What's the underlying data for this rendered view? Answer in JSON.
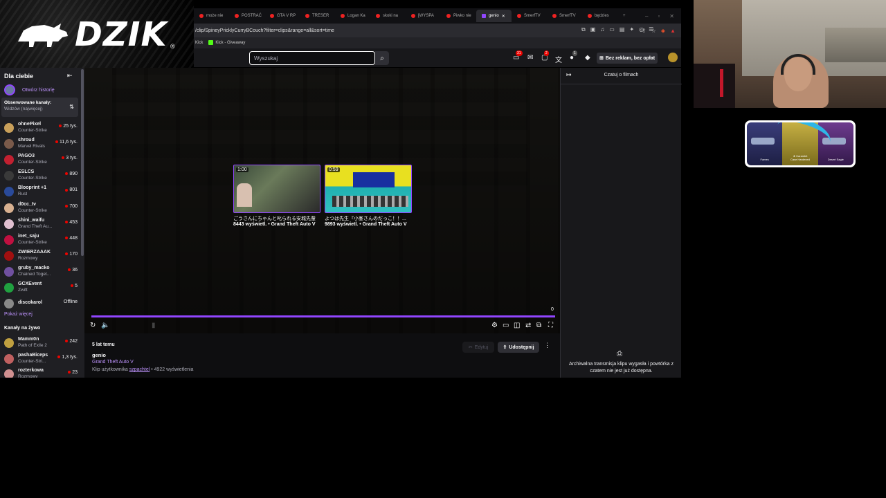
{
  "overlay": {
    "logo_text": "DZIK",
    "logo_mark": "®"
  },
  "browser": {
    "tabs": [
      "może nie",
      "POSTRAĆ",
      "GTA V RP",
      "TRESER",
      "Logan Ka",
      "skoki na",
      "[WYSPA",
      "Piwko nie",
      "genio",
      "SmerfTV",
      "SmerfTV",
      "będzies"
    ],
    "active_tab_index": 8,
    "url": "/clip/SpineyPricklyCurryBCouch?filter=clips&range=all&sort=time",
    "bookmarks": [
      "Kick",
      "Kick - Giveaway"
    ]
  },
  "twitch_nav": {
    "search_placeholder": "Wyszukaj",
    "badges": {
      "notifications": "31",
      "whispers": "2",
      "drops": "1"
    },
    "adfree_label": "Bez reklam, bez opłat"
  },
  "sidebar": {
    "header": "Dla ciebie",
    "open_history": "Otwórz historię",
    "followed_title": "Obserwowane kanały:",
    "followed_sort": "Widzów (najwięcej)",
    "followed": [
      {
        "name": "ohnePixel",
        "game": "Counter-Strike",
        "viewers": "25 tys.",
        "live": true,
        "color": "#c9a05a"
      },
      {
        "name": "shroud",
        "game": "Marvel Rivals",
        "viewers": "11,6 tys.",
        "live": true,
        "color": "#7a5a4a"
      },
      {
        "name": "PAGO3",
        "game": "Counter-Strike",
        "viewers": "3 tys.",
        "live": true,
        "color": "#c22030"
      },
      {
        "name": "ESLCS",
        "game": "Counter-Strike",
        "viewers": "890",
        "live": true,
        "color": "#3a3a3a"
      },
      {
        "name": "Blooprint +1",
        "game": "Rust",
        "viewers": "801",
        "live": true,
        "color": "#2a4a9a"
      },
      {
        "name": "d0cc_tv",
        "game": "Counter-Strike",
        "viewers": "700",
        "live": true,
        "color": "#d8b090"
      },
      {
        "name": "shini_waifu",
        "game": "Grand Theft Au...",
        "viewers": "453",
        "live": true,
        "color": "#e0c0d0"
      },
      {
        "name": "inet_saju",
        "game": "Counter-Strike",
        "viewers": "448",
        "live": true,
        "color": "#c01040"
      },
      {
        "name": "ZWIERZAAAK",
        "game": "Rozmowy",
        "viewers": "170",
        "live": true,
        "color": "#a01010"
      },
      {
        "name": "gruby_macko",
        "game": "Chained Toget...",
        "viewers": "36",
        "live": true,
        "color": "#7050a0"
      },
      {
        "name": "GCXEvent",
        "game": "Zwift",
        "viewers": "5",
        "live": true,
        "color": "#20a040"
      },
      {
        "name": "discokarol",
        "game": "",
        "viewers": "Offline",
        "live": false,
        "color": "#888888"
      }
    ],
    "show_more": "Pokaż więcej",
    "live_header": "Kanały na żywo",
    "live": [
      {
        "name": "Mamm0n",
        "game": "Path of Exile 2",
        "viewers": "242",
        "live": true,
        "color": "#c0a040"
      },
      {
        "name": "pashaBiceps",
        "game": "Counter-Stri...",
        "viewers": "1,3 tys.",
        "live": true,
        "color": "#c06060"
      },
      {
        "name": "rozterkowa",
        "game": "Rozmowy",
        "viewers": "23",
        "live": true,
        "color": "#d09090"
      }
    ]
  },
  "player": {
    "clips": [
      {
        "duration": "1:00",
        "title": "ごうさんにちゃんと叱られる安城先輩",
        "meta": "8443 wyświetl. • Grand Theft Auto V"
      },
      {
        "duration": "0:59",
        "title": "よつは先生『小峯さんのだっこ！！...",
        "meta": "9893 wyświetl. • Grand Theft Auto V"
      }
    ],
    "time_end": "0",
    "progress": 1.0
  },
  "clip_info": {
    "ago": "5 lat temu",
    "title": "genio",
    "game": "Grand Theft Auto V",
    "by_prefix": "Klip użytkownika",
    "by_user": "szpachtel",
    "views": "4922 wyświetlenia",
    "edit_label": "Edytuj",
    "share_label": "Udostępnij"
  },
  "chat": {
    "title": "Czatuj o filmach",
    "archive_msg": "Archiwalna transmisja klipu wygasła i powtórka z czatem nie jest już dostępna."
  },
  "case_widget": {
    "items": [
      "Fames",
      "★ Karambit",
      "Desert Eagle"
    ],
    "subs": [
      "",
      "Case Hardened",
      ""
    ]
  }
}
